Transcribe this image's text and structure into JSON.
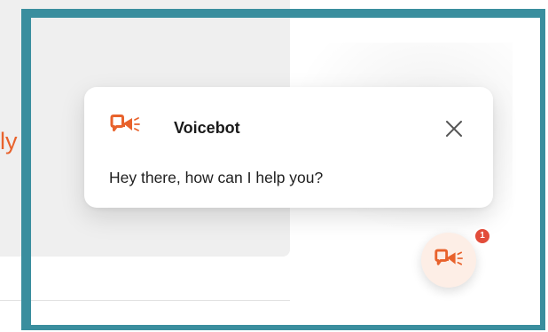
{
  "background": {
    "partial_text": "ly"
  },
  "popup": {
    "title": "Voicebot",
    "message": "Hey there, how can I help you?",
    "close_icon": "close-icon",
    "logo_icon": "voicebot-logo-icon"
  },
  "launcher": {
    "icon": "voicebot-logo-icon",
    "badge_count": "1"
  },
  "colors": {
    "brand": "#e8622c",
    "frame": "#3a8e9e",
    "badge": "#e24d3b",
    "launcher_bg": "#fdeee6"
  }
}
